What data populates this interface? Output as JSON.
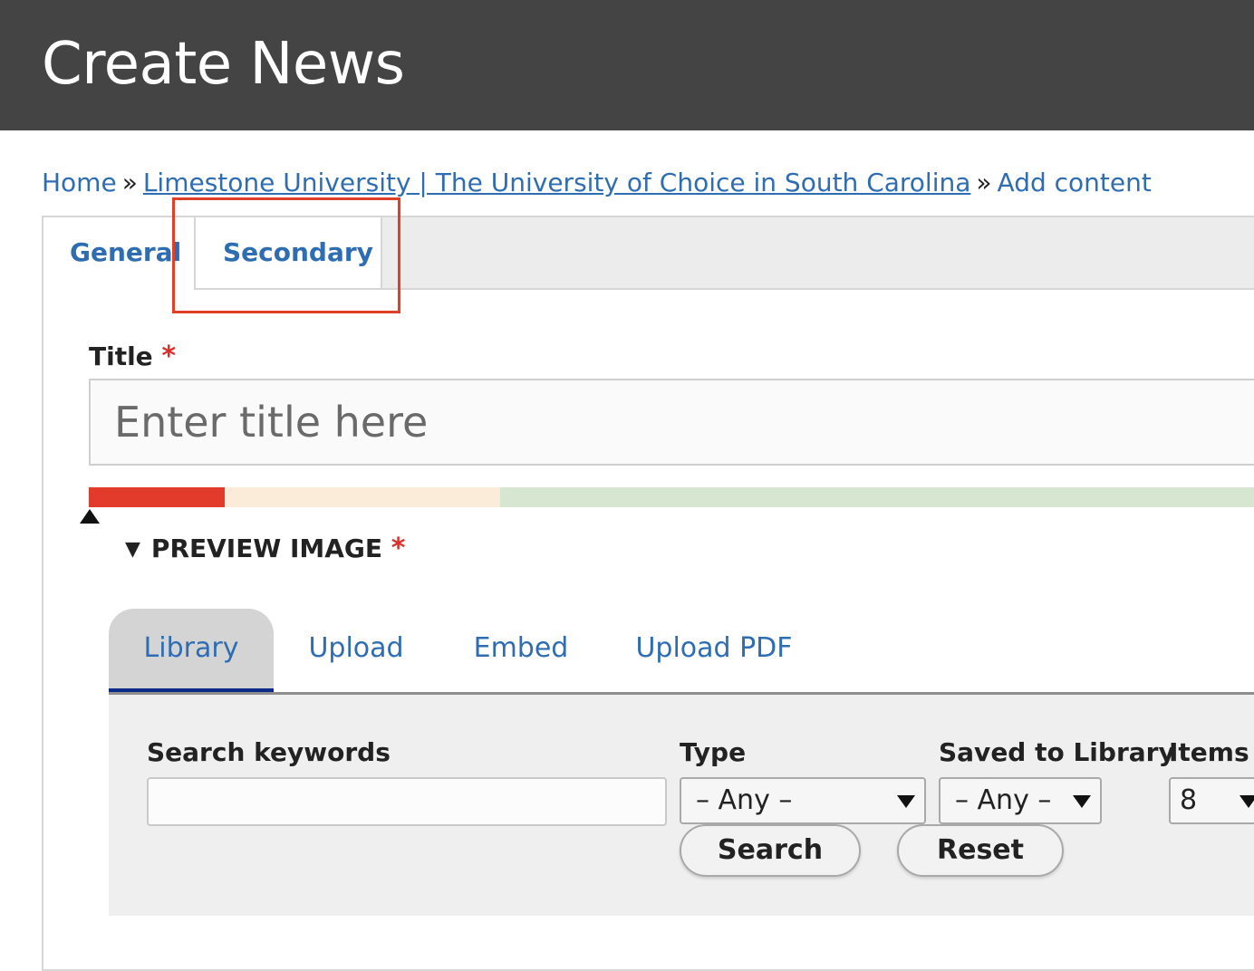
{
  "header": {
    "title": "Create News"
  },
  "breadcrumb": {
    "items": [
      "Home",
      "Limestone University | The University of Choice in South Carolina",
      "Add content"
    ],
    "separator": "»"
  },
  "tabs": [
    {
      "label": "General",
      "active": true
    },
    {
      "label": "Secondary",
      "active": false,
      "highlighted": true
    }
  ],
  "title_field": {
    "label": "Title",
    "required_mark": "*",
    "value": "",
    "placeholder": "Enter title here"
  },
  "preview_image": {
    "label": "PREVIEW IMAGE",
    "required_mark": "*",
    "expanded": true,
    "media_tabs": [
      {
        "label": "Library",
        "active": true
      },
      {
        "label": "Upload",
        "active": false
      },
      {
        "label": "Embed",
        "active": false
      },
      {
        "label": "Upload PDF",
        "active": false
      }
    ],
    "filters": {
      "search_label": "Search keywords",
      "search_value": "",
      "type_label": "Type",
      "type_value": "– Any –",
      "saved_label": "Saved to Library",
      "saved_value": "– Any –",
      "items_label": "Items",
      "items_value": "8",
      "search_button": "Search",
      "reset_button": "Reset"
    }
  },
  "colors": {
    "header_bg": "#444444",
    "link": "#2f6db3",
    "required": "#d9302c",
    "highlight": "#e0402a",
    "meter_red": "#e23a2b",
    "meter_orange": "#fbecd9",
    "meter_green": "#d7e6d1",
    "active_tab_underline": "#0b2a8a"
  }
}
